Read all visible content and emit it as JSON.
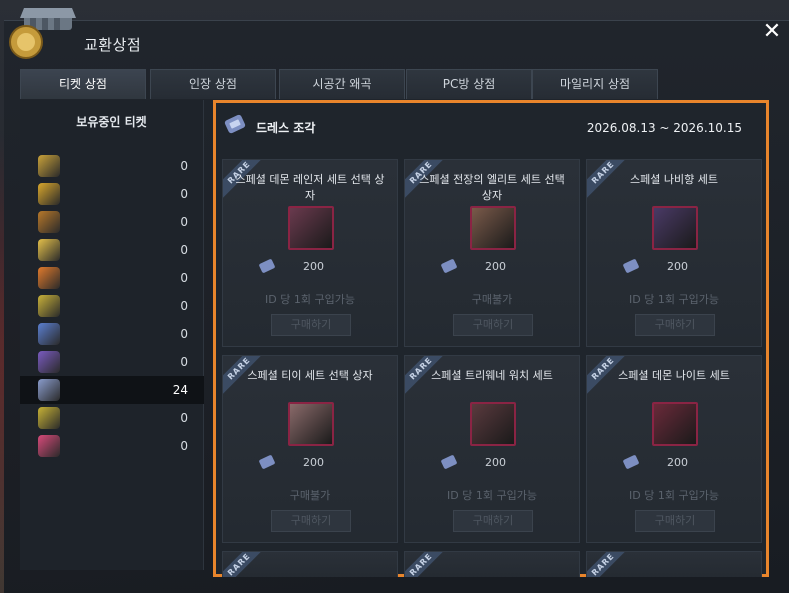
{
  "window": {
    "title": "교환상점",
    "close_label": "✕"
  },
  "tabs": [
    {
      "label": "티켓 상점",
      "active": true
    },
    {
      "label": "인장 상점",
      "active": false
    },
    {
      "label": "시공간 왜곡",
      "active": false
    },
    {
      "label": "PC방 상점",
      "active": false
    },
    {
      "label": "마일리지 상점",
      "active": false
    }
  ],
  "left_panel": {
    "header": "보유중인 티켓",
    "tickets": [
      {
        "icon": "gold-bar-ticket-icon",
        "color": "#c9a23a",
        "count": "0"
      },
      {
        "icon": "gold-coin-ticket-icon",
        "color": "#d9a72c",
        "count": "0"
      },
      {
        "icon": "pouch-ticket-icon",
        "color": "#b7782a",
        "count": "0"
      },
      {
        "icon": "character-ticket-icon",
        "color": "#e4c04a",
        "count": "0"
      },
      {
        "icon": "orange-ticket-icon",
        "color": "#e07a2c",
        "count": "0"
      },
      {
        "icon": "yellow-coin-ticket-icon",
        "color": "#c8b13a",
        "count": "0"
      },
      {
        "icon": "blue-box-ticket-icon",
        "color": "#5b7fd0",
        "count": "0"
      },
      {
        "icon": "purple-plus-ticket-icon",
        "color": "#7a5bc0",
        "count": "0"
      },
      {
        "icon": "dress-piece-ticket-icon",
        "color": "#8a9ccc",
        "count": "24",
        "selected": true
      },
      {
        "icon": "today-ticket-icon",
        "color": "#c7b236",
        "count": "0"
      },
      {
        "icon": "month-ticket-icon",
        "color": "#d84a7a",
        "count": "0"
      }
    ]
  },
  "main": {
    "title": "드레스 조각",
    "date_range": "2026.08.13 ~ 2026.10.15",
    "rare_label": "RARE",
    "cards": [
      {
        "name": "스페셜 데몬 레인저 세트 선택 상자",
        "cost": "200",
        "limit": "ID 당 1회 구입가능",
        "button": "구매하기",
        "thumb": "#6a3a4e"
      },
      {
        "name": "스페셜 전장의 엘리트 세트 선택 상자",
        "cost": "200",
        "limit": "구매불가",
        "button": "구매하기",
        "thumb": "#7a5a4a"
      },
      {
        "name": "스페셜 나비향 세트",
        "cost": "200",
        "limit": "ID 당 1회 구입가능",
        "button": "구매하기",
        "thumb": "#4a3a66"
      },
      {
        "name": "스페셜 티이 세트 선택 상자",
        "cost": "200",
        "limit": "구매불가",
        "button": "구매하기",
        "thumb": "#8a6a6a"
      },
      {
        "name": "스페셜 트리웨네 워치 세트",
        "cost": "200",
        "limit": "ID 당 1회 구입가능",
        "button": "구매하기",
        "thumb": "#5a3a3e"
      },
      {
        "name": "스페셜 데몬 나이트 세트",
        "cost": "200",
        "limit": "ID 당 1회 구입가능",
        "button": "구매하기",
        "thumb": "#6a2a3a"
      }
    ]
  }
}
